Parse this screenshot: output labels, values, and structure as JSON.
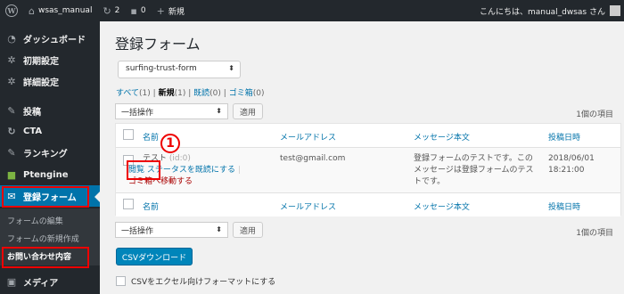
{
  "adminbar": {
    "site_name": "wsas_manual",
    "updates_count": "2",
    "comments_count": "0",
    "new_label": "新規",
    "greeting": "こんにちは、manual_dwsas さん",
    "wp_logo_letter": "W"
  },
  "sidebar": {
    "items": [
      {
        "label": "ダッシュボード",
        "icon": "dashboard-icon",
        "glyph": "◔"
      },
      {
        "label": "初期設定",
        "icon": "gear-icon",
        "glyph": "✲"
      },
      {
        "label": "詳細設定",
        "icon": "gear-icon",
        "glyph": "✲"
      },
      {
        "label": "投稿",
        "icon": "pushpin-icon",
        "glyph": "✎"
      },
      {
        "label": "CTA",
        "icon": "cta-icon",
        "glyph": "↻"
      },
      {
        "label": "ランキング",
        "icon": "ranking-icon",
        "glyph": "✎"
      },
      {
        "label": "Ptengine",
        "icon": "ptengine-icon",
        "glyph": "■"
      },
      {
        "label": "登録フォーム",
        "icon": "form-icon",
        "glyph": "✉"
      },
      {
        "label": "メディア",
        "icon": "media-icon",
        "glyph": "▣"
      }
    ],
    "submenu": [
      "フォームの編集",
      "フォームの新規作成",
      "お問い合わせ内容"
    ]
  },
  "main": {
    "title": "登録フォーム",
    "form_select_value": "surfing-trust-form",
    "filters": {
      "all": "すべて",
      "all_count": "(1)",
      "new": "新規",
      "new_count": "(1)",
      "read": "既読",
      "read_count": "(0)",
      "trash": "ゴミ箱",
      "trash_count": "(0)",
      "sep": "|"
    },
    "bulk_action": "一括操作",
    "apply_label": "適用",
    "items_count": "1個の項目",
    "columns": [
      "名前",
      "メールアドレス",
      "メッセージ本文",
      "投稿日時"
    ],
    "row": {
      "name": "テスト",
      "name_suffix": "(id:0)",
      "email": "test@gmail.com",
      "message": "登録フォームのテストです。このメッセージは登録フォームのテストです。",
      "date": "2018/06/01",
      "time": "18:21:00",
      "action_view": "閲覧",
      "action_mark_read": "ステータスを既読にする",
      "action_sep": "|",
      "action_trash": "ゴミ箱へ移動する"
    },
    "annotation_number": "1",
    "csv_button": "CSVダウンロード",
    "csv_checkbox_label": "CSVをエクセル向けフォーマットにする"
  },
  "colors": {
    "adminbar_bg": "#23282d",
    "accent": "#0073aa",
    "highlight_red": "#e00000",
    "primary_button": "#0085ba"
  }
}
